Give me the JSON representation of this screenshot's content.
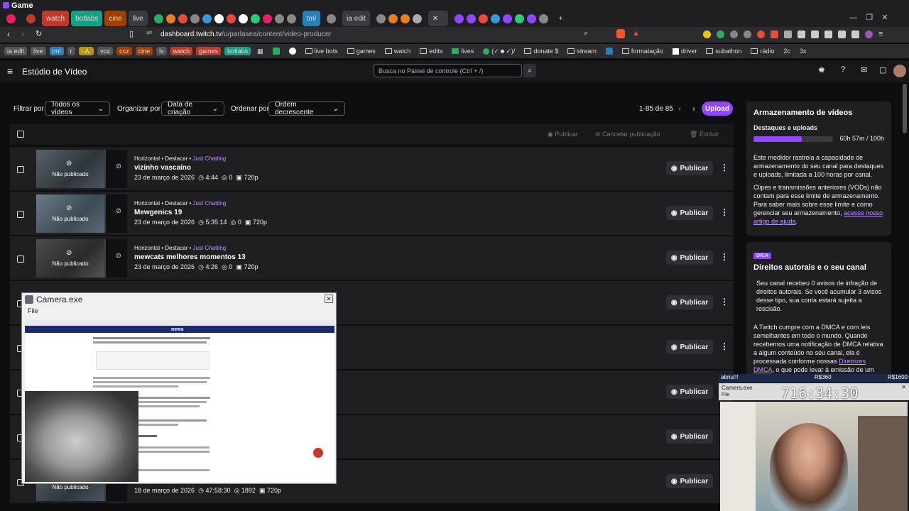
{
  "window": {
    "title": "Game"
  },
  "tabs": [
    {
      "label": "watch",
      "color": "#c0392b"
    },
    {
      "label": "botlabs",
      "color": "#16a085"
    },
    {
      "label": "cine",
      "color": "#d35400"
    },
    {
      "label": "live",
      "color": "#7f8c8d"
    },
    {
      "label": "tml",
      "color": "#2980b9"
    },
    {
      "label": "ia edit",
      "color": "#555"
    }
  ],
  "address": {
    "host": "dashboard.twitch.tv",
    "path": "/u/parlasea/content/video-producer"
  },
  "bookmarks": [
    "ia edit",
    "live",
    "tml",
    "r",
    "I.A.",
    "voz",
    "ccz",
    "cine",
    "lv",
    "watch",
    "games",
    "botlabs",
    "live bots",
    "games",
    "watch",
    "edits",
    "lives",
    "(✓☻✓)/",
    "donate $",
    "stream",
    "formatação",
    "driver",
    "subathon",
    "rádio",
    "2c",
    "3x"
  ],
  "topnav": {
    "title": "Estúdio de Vídeo",
    "search_placeholder": "Busca no Painel de controle (Ctrl + /)"
  },
  "filters": {
    "filter_label": "Filtrar por",
    "filter_value": "Todos os vídeos",
    "organize_label": "Organizar por",
    "organize_value": "Data de criação",
    "order_label": "Ordenar por",
    "order_value": "Ordem decrescente",
    "count": "1-85 de 85",
    "upload": "Upload"
  },
  "bulk": {
    "publish": "Publicar",
    "cancel": "Cancelar publicação",
    "delete": "Excluir"
  },
  "videos": [
    {
      "meta": "Horizontal • Destacar • ",
      "category": "Just Chatting",
      "title": "vizinho vascaíno",
      "date": "23 de março de 2026",
      "duration": "4:44",
      "views": "0",
      "quality": "720p",
      "status": "Não publicado",
      "action": "Publicar"
    },
    {
      "meta": "Horizontal • Destacar • ",
      "category": "Just Chatting",
      "title": "Mewgenics 19",
      "date": "23 de março de 2026",
      "duration": "5:35:14",
      "views": "0",
      "quality": "720p",
      "status": "Não publicado",
      "action": "Publicar"
    },
    {
      "meta": "Horizontal • Destacar • ",
      "category": "Just Chatting",
      "title": "mewcats melhores momentos 13",
      "date": "23 de março de 2026",
      "duration": "4:26",
      "views": "0",
      "quality": "720p",
      "status": "Não publicado",
      "action": "Publicar"
    },
    {
      "action": "Publicar"
    },
    {
      "action": "Publicar"
    },
    {
      "action": "Publicar"
    },
    {
      "action": "Publicar"
    },
    {
      "date": "18 de março de 2026",
      "duration": "47:58:30",
      "views": "1892",
      "quality": "720p",
      "status": "Não publicado",
      "action": "Publicar"
    }
  ],
  "storage": {
    "title": "Armazenamento de vídeos",
    "sub": "Destaques e uploads",
    "usage": "60h 57m / 100h",
    "fill": 0.61,
    "p1": "Este medidor rastreia a capacidade de armazenamento do seu canal para destaques e uploads, limitada a 100 horas por canal.",
    "p2": "Clipes e transmissões anteriores (VODs) não contam para esse limite de armazenamento. Para saber mais sobre esse limite e como gerenciar seu armazenamento,",
    "p2_link": "acesse nosso artigo de ajuda",
    "p2_end": "."
  },
  "tip": {
    "badge": "DICA",
    "title": "Direitos autorais e o seu canal",
    "p1": "Seu canal recebeu 0 avisos de infração de direitos autorais. Se você acumular 3 avisos desse tipo, sua conta estará sujeita a rescisão.",
    "p2": "A Twitch cumpre com a DMCA e com leis semelhantes em todo o mundo. Quando recebemos uma notificação de DMCA relativa a algum conteúdo no seu canal, ela é processada conforme nossas",
    "p2_link": "Diretrizes DMCA",
    "p2_end": ", o que pode levar à emissão de um aviso de infração para a sua conta. Se isso"
  },
  "camera": {
    "title": "Camera.exe",
    "menu": "File",
    "news_logo": "news"
  },
  "overlay": {
    "label": "abriu!!!",
    "amount1": "R$360",
    "amount2": "R$1600",
    "cam_title": "Camera.exe",
    "menu": "File",
    "timer": "716:34:30"
  }
}
